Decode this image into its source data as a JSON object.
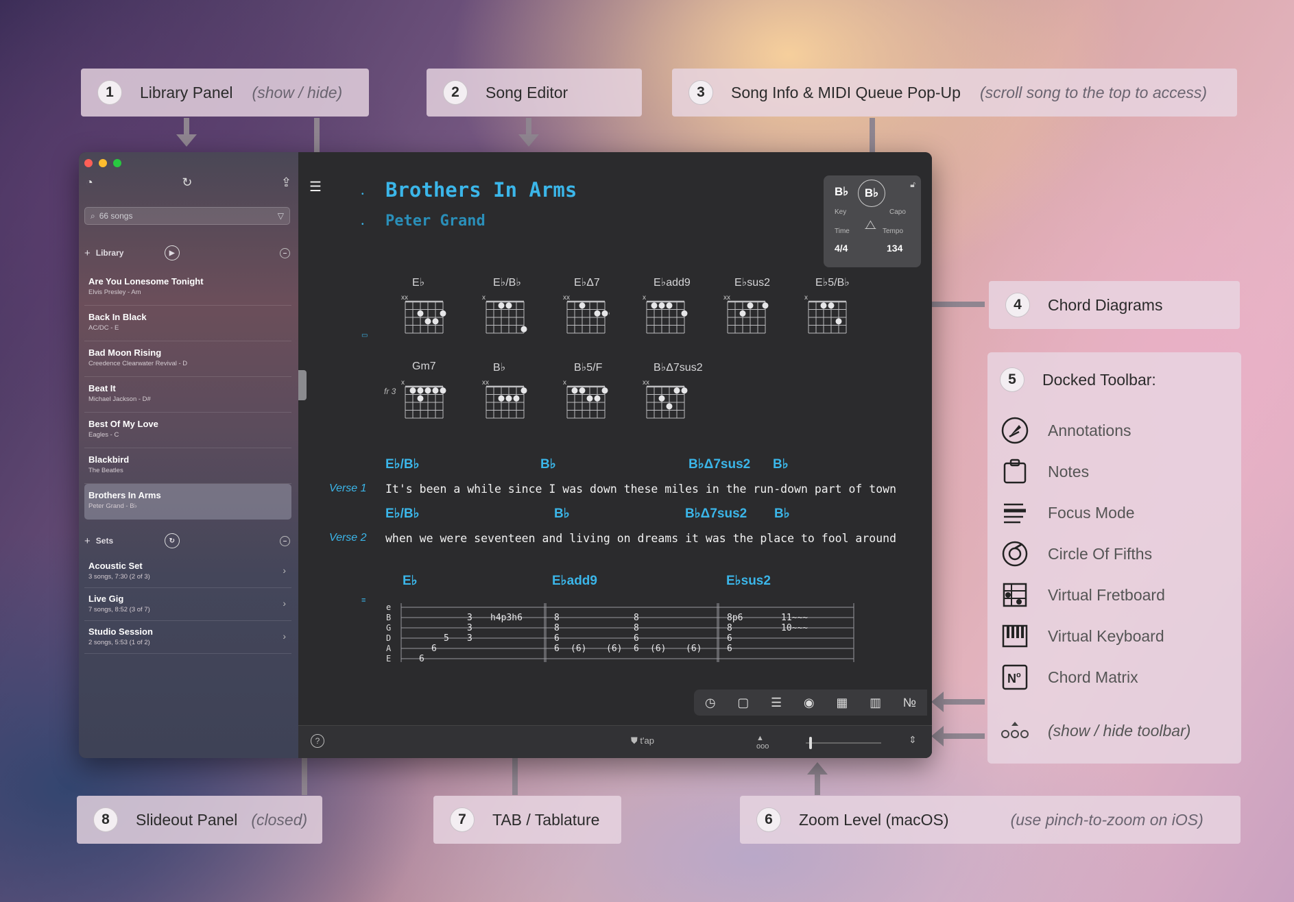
{
  "callouts": {
    "c1": {
      "num": "1",
      "label": "Library Panel",
      "hint": "(show / hide)"
    },
    "c2": {
      "num": "2",
      "label": "Song Editor"
    },
    "c3": {
      "num": "3",
      "label": "Song Info & MIDI Queue Pop-Up",
      "hint": "(scroll song to the top to access)"
    },
    "c4": {
      "num": "4",
      "label": "Chord Diagrams"
    },
    "c5": {
      "num": "5",
      "label": "Docked Toolbar:"
    },
    "c6": {
      "num": "6",
      "label": "Zoom Level (macOS)",
      "hint": "(use pinch-to-zoom on iOS)"
    },
    "c7": {
      "num": "7",
      "label": "TAB / Tablature"
    },
    "c8": {
      "num": "8",
      "label": "Slideout Panel",
      "hint": "(closed)"
    }
  },
  "toolbar_items": [
    {
      "label": "Annotations",
      "icon": "annotations-icon"
    },
    {
      "label": "Notes",
      "icon": "notes-icon"
    },
    {
      "label": "Focus Mode",
      "icon": "focus-mode-icon"
    },
    {
      "label": "Circle Of Fifths",
      "icon": "circle-of-fifths-icon"
    },
    {
      "label": "Virtual Fretboard",
      "icon": "fretboard-icon"
    },
    {
      "label": "Virtual Keyboard",
      "icon": "keyboard-icon"
    },
    {
      "label": "Chord Matrix",
      "icon": "chord-matrix-icon"
    },
    {
      "label": "(show / hide toolbar)",
      "icon": "toolbar-toggle-icon"
    }
  ],
  "sidebar": {
    "search_placeholder": "66 songs",
    "library_label": "Library",
    "sets_label": "Sets",
    "songs": [
      {
        "title": "Are You Lonesome Tonight",
        "sub": "Elvis Presley - Am"
      },
      {
        "title": "Back In Black",
        "sub": "AC/DC - E"
      },
      {
        "title": "Bad Moon Rising",
        "sub": "Creedence Clearwater Revival - D"
      },
      {
        "title": "Beat It",
        "sub": "Michael Jackson - D#"
      },
      {
        "title": "Best Of My Love",
        "sub": "Eagles - C"
      },
      {
        "title": "Blackbird",
        "sub": "The Beatles"
      },
      {
        "title": "Brothers In Arms",
        "sub": "Peter Grand - B♭"
      }
    ],
    "sets": [
      {
        "title": "Acoustic Set",
        "sub": "3 songs, 7:30 (2 of 3)"
      },
      {
        "title": "Live Gig",
        "sub": "7 songs, 8:52 (3 of 7)"
      },
      {
        "title": "Studio Session",
        "sub": "2 songs, 5:53 (1 of 2)"
      }
    ]
  },
  "song": {
    "title": "Brothers In Arms",
    "artist": "Peter Grand"
  },
  "info": {
    "key": "B♭",
    "capo": "B♭",
    "key_label": "Key",
    "capo_label": "Capo",
    "time_label": "Time",
    "tempo_label": "Tempo",
    "time": "4/4",
    "tempo": "134"
  },
  "chords_row1": [
    "E♭",
    "E♭/B♭",
    "E♭Δ7",
    "E♭add9",
    "E♭sus2",
    "E♭5/B♭"
  ],
  "chords_row2": [
    "Gm7",
    "B♭",
    "B♭5/F",
    "B♭Δ7sus2"
  ],
  "fret_label": "fr 3",
  "verses": [
    {
      "label": "Verse 1",
      "text": "It's been a while since I was down these miles in the run-down part of town",
      "chords": [
        "E♭/B♭",
        "B♭",
        "B♭Δ7sus2",
        "B♭"
      ]
    },
    {
      "label": "Verse 2",
      "text": "when we were seventeen and living on dreams it was the place to fool around",
      "chords": [
        "E♭/B♭",
        "B♭",
        "B♭Δ7sus2",
        "B♭"
      ]
    }
  ],
  "tab": {
    "chords": [
      "E♭",
      "E♭add9",
      "E♭sus2"
    ],
    "strings": [
      "e",
      "B",
      "G",
      "D",
      "A",
      "E"
    ]
  },
  "bottombar": {
    "help": "?",
    "tap": "t'ap"
  }
}
